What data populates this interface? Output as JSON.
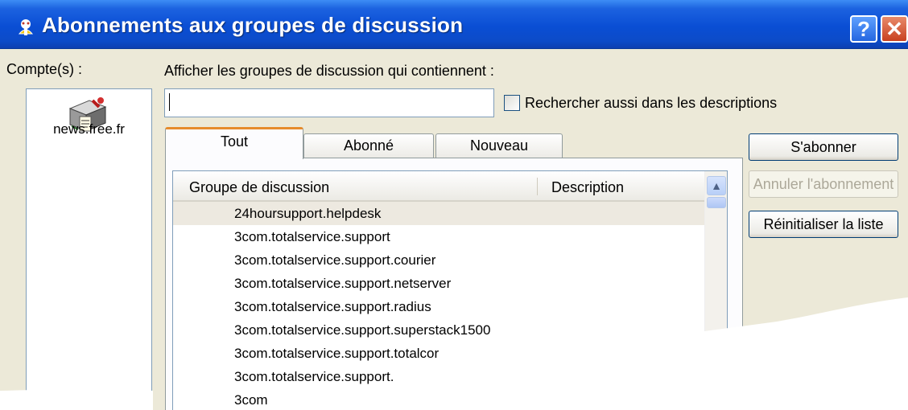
{
  "window": {
    "title": "Abonnements aux groupes de discussion",
    "help_button": "?",
    "close_button": "✕"
  },
  "accounts": {
    "label": "Compte(s) :",
    "items": [
      {
        "name": "news.free.fr",
        "icon": "news-server-icon"
      }
    ]
  },
  "search": {
    "label": "Afficher les groupes de discussion qui contiennent :",
    "value": "",
    "also_descriptions_label": "Rechercher aussi dans les descriptions",
    "also_descriptions_checked": false
  },
  "tabs": [
    {
      "label": "Tout",
      "active": true
    },
    {
      "label": "Abonné",
      "active": false
    },
    {
      "label": "Nouveau",
      "active": false
    }
  ],
  "list": {
    "columns": [
      "Groupe de discussion",
      "Description"
    ],
    "rows": [
      "24hoursupport.helpdesk",
      "3com.totalservice.support",
      "3com.totalservice.support.courier",
      "3com.totalservice.support.netserver",
      "3com.totalservice.support.radius",
      "3com.totalservice.support.superstack1500",
      "3com.totalservice.support.totalcor",
      "3com.totalservice.support.",
      "3com"
    ],
    "selected_index": 0
  },
  "buttons": {
    "subscribe": "S'abonner",
    "unsubscribe": "Annuler l'abonnement",
    "reset": "Réinitialiser la liste"
  },
  "colors": {
    "titlebar": "#0a4ed4",
    "dialog_bg": "#ece9d8",
    "active_tab_accent": "#e68b2c",
    "selected_row": "#ede9e0"
  }
}
